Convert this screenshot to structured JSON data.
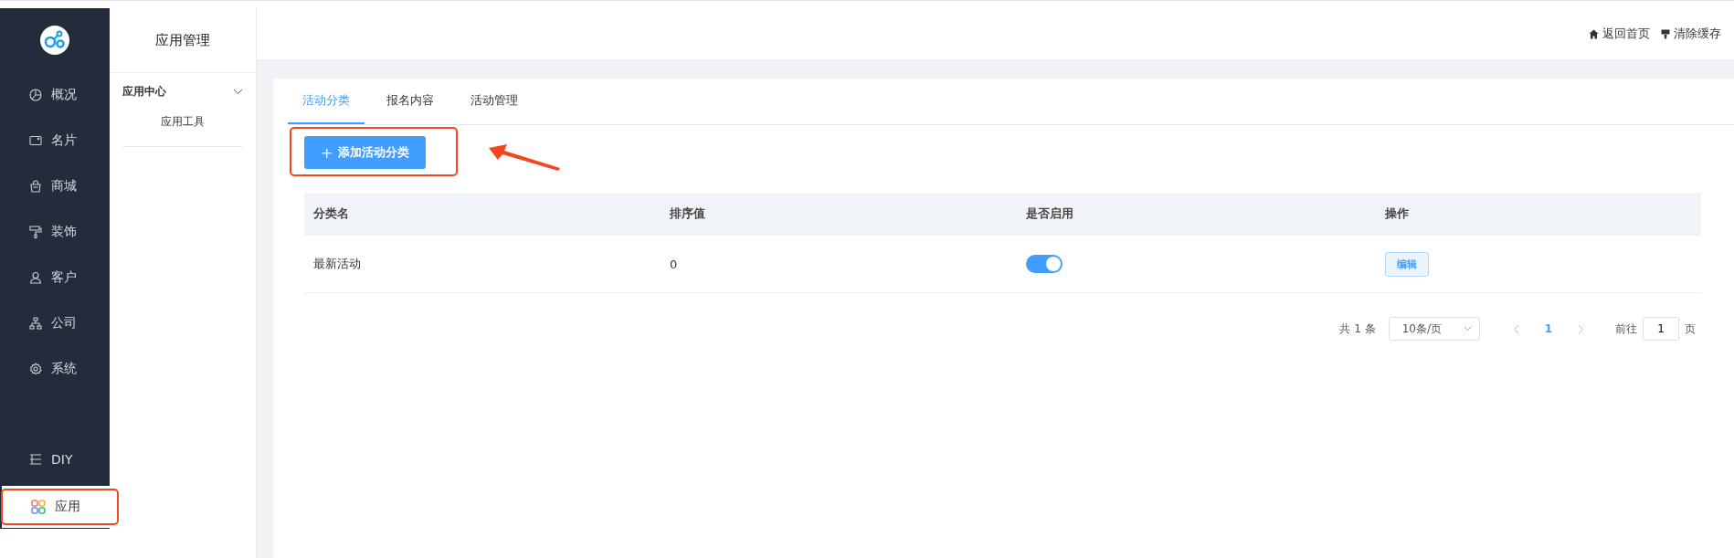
{
  "sidebar": {
    "items": [
      {
        "label": "概况",
        "selected": false
      },
      {
        "label": "名片",
        "selected": false
      },
      {
        "label": "商城",
        "selected": false
      },
      {
        "label": "装饰",
        "selected": false
      },
      {
        "label": "客户",
        "selected": false
      },
      {
        "label": "公司",
        "selected": false
      },
      {
        "label": "系统",
        "selected": false
      }
    ],
    "bottom_items": [
      {
        "label": "DIY",
        "selected": false
      },
      {
        "label": "应用",
        "selected": true
      }
    ]
  },
  "subnav": {
    "title": "应用管理",
    "groups": [
      {
        "label": "应用中心",
        "expanded": true,
        "children": [
          {
            "label": "应用工具"
          }
        ]
      }
    ]
  },
  "header": {
    "links": [
      "返回首页",
      "清除缓存"
    ]
  },
  "tabs": [
    {
      "label": "活动分类",
      "selected": true
    },
    {
      "label": "报名内容",
      "selected": false
    },
    {
      "label": "活动管理",
      "selected": false
    }
  ],
  "add_button": {
    "icon_text": "+",
    "label": "添加活动分类"
  },
  "table": {
    "columns": [
      "分类名",
      "排序值",
      "是否启用",
      "操作"
    ],
    "rows": [
      {
        "name": "最新活动",
        "sort": "0",
        "on": true,
        "action": "编辑"
      }
    ]
  },
  "pagination": {
    "total": "共 1 条",
    "page_size": "10条/页",
    "pages": [
      {
        "label": "1",
        "selected": true
      }
    ],
    "goto_label": "前往",
    "goto_value": "1",
    "goto_suffix": "页"
  }
}
